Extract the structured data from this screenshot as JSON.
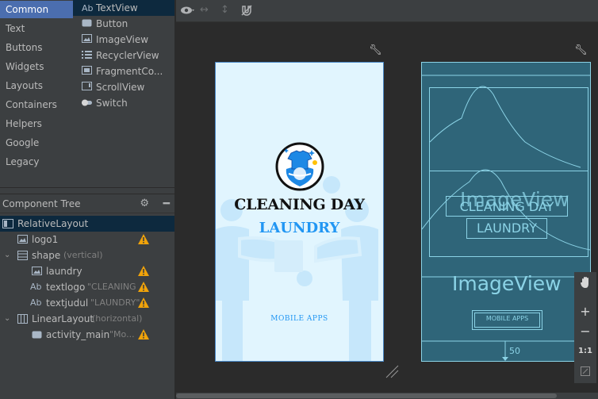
{
  "palette": {
    "categories": [
      "Common",
      "Text",
      "Buttons",
      "Widgets",
      "Layouts",
      "Containers",
      "Helpers",
      "Google",
      "Legacy"
    ],
    "selected_category": "Common",
    "items": [
      {
        "icon": "Ab",
        "label": "TextView"
      },
      {
        "icon": "button-icon",
        "label": "Button"
      },
      {
        "icon": "image-icon",
        "label": "ImageView"
      },
      {
        "icon": "list-icon",
        "label": "RecyclerView"
      },
      {
        "icon": "fragment-icon",
        "label": "FragmentCo..."
      },
      {
        "icon": "scroll-icon",
        "label": "ScrollView"
      },
      {
        "icon": "switch-icon",
        "label": "Switch"
      }
    ]
  },
  "tree": {
    "header": "Component Tree",
    "rows": [
      {
        "label": "RelativeLayout",
        "hint": "",
        "icon": "relative-layout-icon",
        "warning": false
      },
      {
        "label": "logo1",
        "hint": "",
        "icon": "image-icon",
        "warning": true
      },
      {
        "label": "shape",
        "hint": "(vertical)",
        "icon": "linear-layout-icon",
        "warning": false
      },
      {
        "label": "laundry",
        "hint": "",
        "icon": "image-icon",
        "warning": true
      },
      {
        "label": "textlogo",
        "hint": "\"CLEANING D",
        "icon": "Ab",
        "warning": true
      },
      {
        "label": "textjudul",
        "hint": "\"LAUNDRY\"",
        "icon": "Ab",
        "warning": true
      },
      {
        "label": "LinearLayout",
        "hint": "(horizontal)",
        "icon": "linear-layout-icon",
        "warning": false
      },
      {
        "label": "activity_main",
        "hint": "\"Mo...",
        "icon": "button-icon",
        "warning": true
      }
    ]
  },
  "design": {
    "title_line1": "CLEANING DAY",
    "title_line2": "LAUNDRY",
    "footer": "MOBILE APPS"
  },
  "blueprint": {
    "imageview_label": "ImageView",
    "text1": "CLEANING DAY",
    "text2": "LAUNDRY",
    "button": "MOBILE APPS",
    "margin": "50"
  },
  "zoom": {
    "plus": "+",
    "minus": "−",
    "one_to_one": "1:1"
  },
  "colors": {
    "accent": "#2196f3",
    "blueprint_bg": "#2f6579",
    "warning": "#f0a30a"
  }
}
